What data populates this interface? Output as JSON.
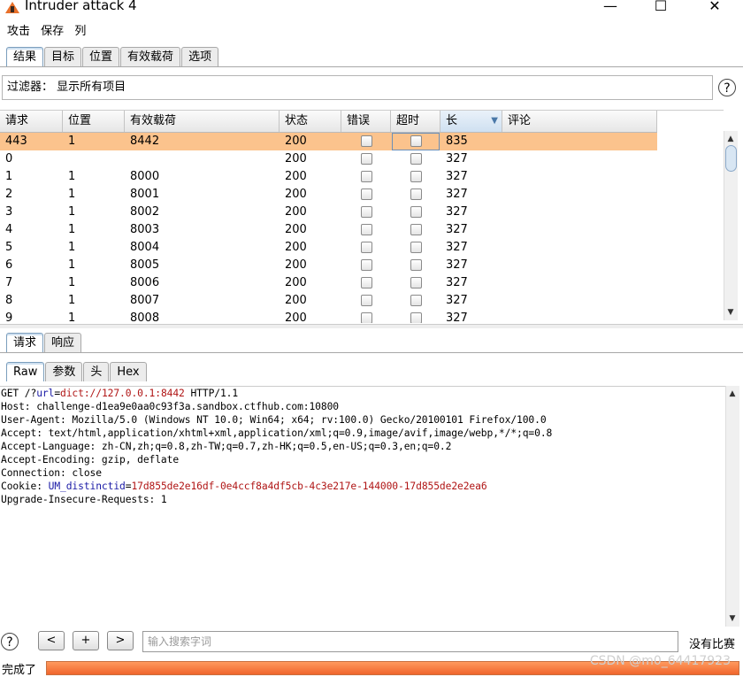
{
  "window": {
    "title": "Intruder attack 4",
    "minimize": "—",
    "maximize": "☐",
    "close": "✕"
  },
  "menu": [
    "攻击",
    "保存",
    "列"
  ],
  "main_tabs": [
    {
      "label": "结果",
      "active": true
    },
    {
      "label": "目标",
      "active": false
    },
    {
      "label": "位置",
      "active": false
    },
    {
      "label": "有效载荷",
      "active": false
    },
    {
      "label": "选项",
      "active": false
    }
  ],
  "filter": {
    "text": "过滤器： 显示所有项目"
  },
  "help_glyph": "?",
  "table": {
    "columns": [
      "请求",
      "位置",
      "有效载荷",
      "状态",
      "错误",
      "超时",
      "长",
      "评论"
    ],
    "sorted_column": "长",
    "rows": [
      {
        "req": "443",
        "pos": "1",
        "payload": "8442",
        "status": "200",
        "len": "835",
        "selected": true
      },
      {
        "req": "0",
        "pos": "",
        "payload": "",
        "status": "200",
        "len": "327"
      },
      {
        "req": "1",
        "pos": "1",
        "payload": "8000",
        "status": "200",
        "len": "327"
      },
      {
        "req": "2",
        "pos": "1",
        "payload": "8001",
        "status": "200",
        "len": "327"
      },
      {
        "req": "3",
        "pos": "1",
        "payload": "8002",
        "status": "200",
        "len": "327"
      },
      {
        "req": "4",
        "pos": "1",
        "payload": "8003",
        "status": "200",
        "len": "327"
      },
      {
        "req": "5",
        "pos": "1",
        "payload": "8004",
        "status": "200",
        "len": "327"
      },
      {
        "req": "6",
        "pos": "1",
        "payload": "8005",
        "status": "200",
        "len": "327"
      },
      {
        "req": "7",
        "pos": "1",
        "payload": "8006",
        "status": "200",
        "len": "327"
      },
      {
        "req": "8",
        "pos": "1",
        "payload": "8007",
        "status": "200",
        "len": "327"
      },
      {
        "req": "9",
        "pos": "1",
        "payload": "8008",
        "status": "200",
        "len": "327"
      }
    ]
  },
  "detail_tabs": [
    {
      "label": "请求",
      "active": true
    },
    {
      "label": "响应",
      "active": false
    }
  ],
  "view_tabs": [
    {
      "label": "Raw",
      "active": true
    },
    {
      "label": "参数",
      "active": false
    },
    {
      "label": "头",
      "active": false
    },
    {
      "label": "Hex",
      "active": false
    }
  ],
  "request": {
    "line1": {
      "a": "GET /?",
      "b": "url",
      "c": "=",
      "d": "dict://127.0.0.1:8442",
      "e": " HTTP/1.1"
    },
    "host": "Host: challenge-d1ea9e0aa0c93f3a.sandbox.ctfhub.com:10800",
    "ua": "User-Agent: Mozilla/5.0 (Windows NT 10.0; Win64; x64; rv:100.0) Gecko/20100101 Firefox/100.0",
    "accept": "Accept: text/html,application/xhtml+xml,application/xml;q=0.9,image/avif,image/webp,*/*;q=0.8",
    "lang": "Accept-Language: zh-CN,zh;q=0.8,zh-TW;q=0.7,zh-HK;q=0.5,en-US;q=0.3,en;q=0.2",
    "enc": "Accept-Encoding: gzip, deflate",
    "conn": "Connection: close",
    "cookie": {
      "a": "Cookie: ",
      "b": "UM_distinctid",
      "c": "=",
      "d": "17d855de2e16df-0e4ccf8a4df5cb-4c3e217e-144000-17d855de2e2ea6"
    },
    "upgrade": "Upgrade-Insecure-Requests: 1"
  },
  "bottom": {
    "prev": "<",
    "add": "+",
    "next": ">",
    "search_placeholder": "输入搜索字词",
    "match_status": "没有比赛"
  },
  "status": {
    "text": "完成了",
    "progress": 1.0,
    "watermark": "CSDN @m0_64417923"
  },
  "colors": {
    "selected_row": "#fbc38d",
    "progress": "#f0652c",
    "accent": "#e8702a"
  }
}
